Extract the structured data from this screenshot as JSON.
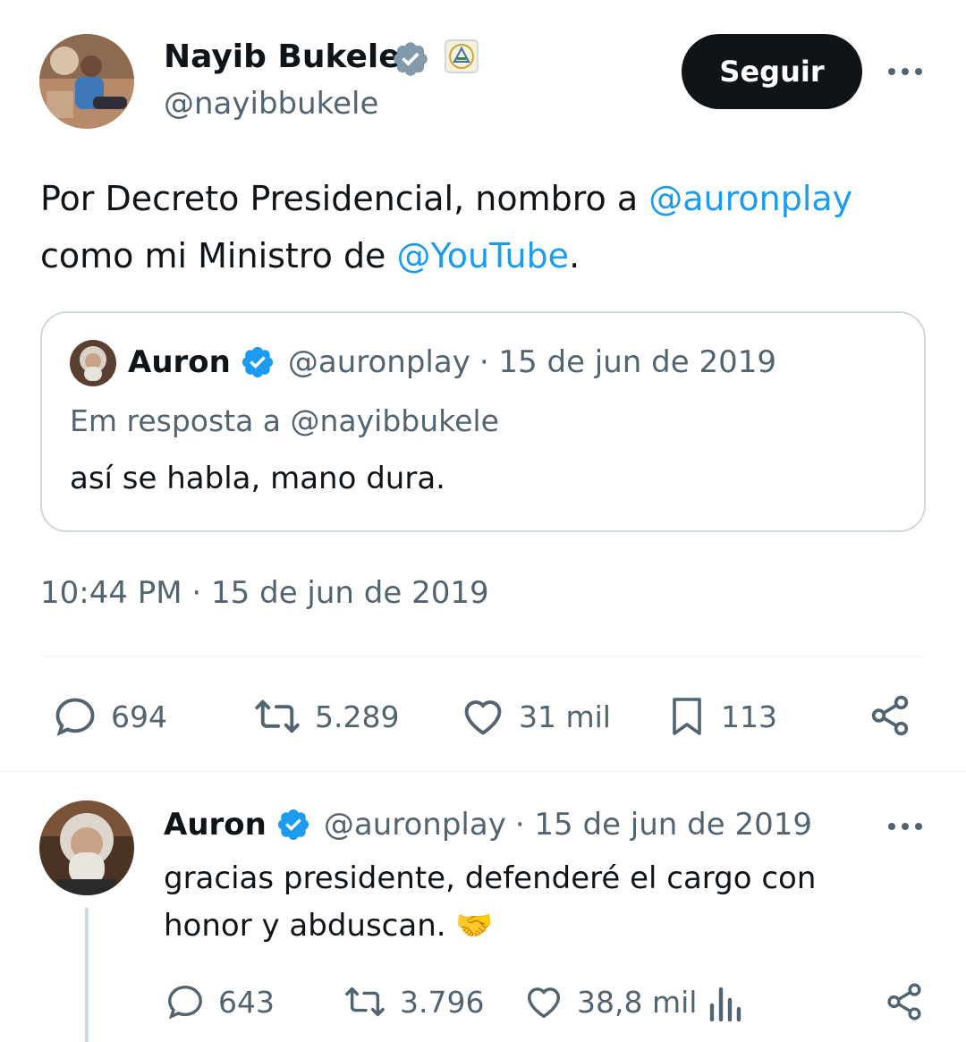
{
  "main_tweet": {
    "author_name": "Nayib Bukele",
    "author_handle": "@nayibbukele",
    "follow_label": "Seguir",
    "text_prefix": "Por Decreto Presidencial, nombro a ",
    "mention1": "@auronplay",
    "text_mid": "como mi Ministro de ",
    "mention2": "@YouTube",
    "text_suffix": ".",
    "timestamp": "10:44 PM · 15 de jun de 2019",
    "stats": {
      "replies": "694",
      "retweets": "5.289",
      "likes": "31 mil",
      "bookmarks": "113"
    }
  },
  "quoted_tweet": {
    "author_name": "Auron",
    "author_handle": "@auronplay",
    "date": "· 15 de jun de 2019",
    "reply_to": "Em resposta a @nayibbukele",
    "text": "así se habla, mano dura."
  },
  "reply_tweet": {
    "author_name": "Auron",
    "author_handle": "@auronplay",
    "date": "· 15 de jun de 2019",
    "text_line1": "gracias presidente, defenderé el cargo con",
    "text_line2": "honor y abduscan.",
    "emoji": "🤝",
    "stats": {
      "replies": "643",
      "retweets": "3.796",
      "likes": "38,8 mil"
    }
  },
  "colors": {
    "accent": "#1d9bf0",
    "text": "#0f1419",
    "muted": "#536471",
    "follow_bg": "#0f1419"
  }
}
